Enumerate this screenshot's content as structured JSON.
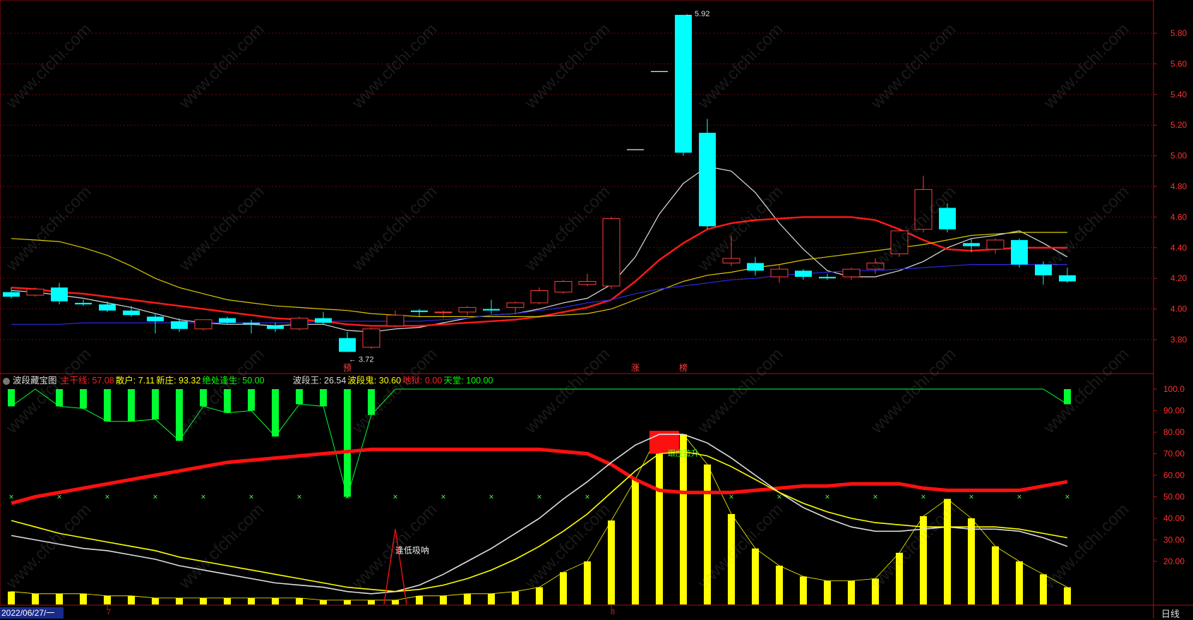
{
  "indicator_header": {
    "name": "波段藏宝图",
    "items": [
      {
        "label": "主干线",
        "value": "57.08",
        "color": "#ff2020"
      },
      {
        "label": "散户",
        "value": "7.11",
        "color": "#ffff00"
      },
      {
        "label": "新庄",
        "value": "93.32",
        "color": "#ffff00"
      },
      {
        "label": "绝处逢生",
        "value": "50.00",
        "color": "#00ff00"
      },
      {
        "label": "波段王",
        "value": "26.54",
        "color": "#dddddd"
      },
      {
        "label": "波段鬼",
        "value": "30.60",
        "color": "#ffff00"
      },
      {
        "label": "地狱",
        "value": "0.00",
        "color": "#ff2020"
      },
      {
        "label": "天堂",
        "value": "100.00",
        "color": "#00ff00"
      }
    ]
  },
  "date_label": "2022/06/27/一",
  "period_label": "日线",
  "watermark": "www.cfchi.com",
  "chart_data": [
    {
      "type": "candlestick",
      "title": "",
      "ylim": [
        3.62,
        5.98
      ],
      "price_ticks": [
        "5.80",
        "5.60",
        "5.40",
        "5.20",
        "5.00",
        "4.80",
        "4.60",
        "4.40",
        "4.20",
        "4.00",
        "3.80"
      ],
      "candles": [
        {
          "o": 4.11,
          "h": 4.14,
          "l": 4.07,
          "c": 4.08
        },
        {
          "o": 4.09,
          "h": 4.14,
          "l": 4.08,
          "c": 4.13
        },
        {
          "o": 4.14,
          "h": 4.17,
          "l": 4.03,
          "c": 4.05
        },
        {
          "o": 4.04,
          "h": 4.06,
          "l": 4.02,
          "c": 4.03
        },
        {
          "o": 4.03,
          "h": 4.05,
          "l": 3.98,
          "c": 3.99
        },
        {
          "o": 3.99,
          "h": 4.02,
          "l": 3.95,
          "c": 3.96
        },
        {
          "o": 3.95,
          "h": 3.97,
          "l": 3.84,
          "c": 3.92
        },
        {
          "o": 3.92,
          "h": 3.94,
          "l": 3.85,
          "c": 3.87
        },
        {
          "o": 3.87,
          "h": 3.93,
          "l": 3.86,
          "c": 3.93
        },
        {
          "o": 3.94,
          "h": 3.95,
          "l": 3.9,
          "c": 3.91
        },
        {
          "o": 3.91,
          "h": 3.93,
          "l": 3.84,
          "c": 3.9
        },
        {
          "o": 3.89,
          "h": 3.91,
          "l": 3.85,
          "c": 3.87
        },
        {
          "o": 3.87,
          "h": 3.95,
          "l": 3.86,
          "c": 3.94
        },
        {
          "o": 3.94,
          "h": 3.98,
          "l": 3.9,
          "c": 3.91
        },
        {
          "o": 3.81,
          "h": 3.85,
          "l": 3.72,
          "c": 3.72
        },
        {
          "o": 3.75,
          "h": 3.88,
          "l": 3.74,
          "c": 3.87
        },
        {
          "o": 3.89,
          "h": 3.99,
          "l": 3.88,
          "c": 3.96
        },
        {
          "o": 3.99,
          "h": 4.0,
          "l": 3.95,
          "c": 3.98
        },
        {
          "o": 3.98,
          "h": 3.99,
          "l": 3.94,
          "c": 3.98
        },
        {
          "o": 3.98,
          "h": 4.02,
          "l": 3.96,
          "c": 4.01
        },
        {
          "o": 4.0,
          "h": 4.06,
          "l": 3.97,
          "c": 3.99
        },
        {
          "o": 4.01,
          "h": 4.05,
          "l": 3.97,
          "c": 4.04
        },
        {
          "o": 4.04,
          "h": 4.14,
          "l": 4.03,
          "c": 4.12
        },
        {
          "o": 4.11,
          "h": 4.19,
          "l": 4.1,
          "c": 4.18
        },
        {
          "o": 4.16,
          "h": 4.23,
          "l": 4.15,
          "c": 4.18
        },
        {
          "o": 4.15,
          "h": 4.6,
          "l": 4.13,
          "c": 4.59
        },
        {
          "o": 5.04,
          "h": 5.04,
          "l": 5.04,
          "c": 5.04
        },
        {
          "o": 5.55,
          "h": 5.55,
          "l": 5.55,
          "c": 5.55
        },
        {
          "o": 5.92,
          "h": 5.92,
          "l": 5.0,
          "c": 5.02
        },
        {
          "o": 5.15,
          "h": 5.24,
          "l": 4.52,
          "c": 4.54
        },
        {
          "o": 4.3,
          "h": 4.48,
          "l": 4.28,
          "c": 4.33
        },
        {
          "o": 4.3,
          "h": 4.34,
          "l": 4.22,
          "c": 4.25
        },
        {
          "o": 4.21,
          "h": 4.29,
          "l": 4.17,
          "c": 4.26
        },
        {
          "o": 4.25,
          "h": 4.26,
          "l": 4.19,
          "c": 4.21
        },
        {
          "o": 4.21,
          "h": 4.23,
          "l": 4.19,
          "c": 4.2
        },
        {
          "o": 4.21,
          "h": 4.27,
          "l": 4.19,
          "c": 4.26
        },
        {
          "o": 4.26,
          "h": 4.33,
          "l": 4.23,
          "c": 4.3
        },
        {
          "o": 4.36,
          "h": 4.52,
          "l": 4.34,
          "c": 4.51
        },
        {
          "o": 4.52,
          "h": 4.87,
          "l": 4.5,
          "c": 4.78
        },
        {
          "o": 4.66,
          "h": 4.69,
          "l": 4.5,
          "c": 4.52
        },
        {
          "o": 4.43,
          "h": 4.46,
          "l": 4.37,
          "c": 4.41
        },
        {
          "o": 4.39,
          "h": 4.46,
          "l": 4.36,
          "c": 4.45
        },
        {
          "o": 4.45,
          "h": 4.46,
          "l": 4.27,
          "c": 4.29
        },
        {
          "o": 4.29,
          "h": 4.31,
          "l": 4.16,
          "c": 4.22
        },
        {
          "o": 4.22,
          "h": 4.27,
          "l": 4.17,
          "c": 4.18
        }
      ],
      "annotations": [
        {
          "text": "5.92",
          "index": 28,
          "price": 5.92,
          "color": "#dddddd"
        },
        {
          "text": "3.72",
          "index": 14,
          "price": 3.72,
          "color": "#dddddd"
        }
      ],
      "marks": [
        {
          "text": "预",
          "index": 14,
          "color": "#ff4040"
        },
        {
          "text": "涨",
          "index": 26,
          "color": "#ff4040"
        },
        {
          "text": "榜",
          "index": 28,
          "color": "#ff4040"
        }
      ],
      "series": [
        {
          "color": "#dddddd",
          "values": [
            4.12,
            4.11,
            4.09,
            4.07,
            4.04,
            4.01,
            3.97,
            3.93,
            3.91,
            3.9,
            3.9,
            3.89,
            3.9,
            3.9,
            3.86,
            3.85,
            3.87,
            3.88,
            3.91,
            3.94,
            3.96,
            3.97,
            4.0,
            4.04,
            4.07,
            4.16,
            4.34,
            4.62,
            4.82,
            4.93,
            4.9,
            4.76,
            4.56,
            4.39,
            4.25,
            4.21,
            4.21,
            4.25,
            4.31,
            4.4,
            4.46,
            4.48,
            4.51,
            4.43,
            4.34
          ]
        },
        {
          "color": "#ff1a1a",
          "values": [
            4.14,
            4.13,
            4.11,
            4.1,
            4.08,
            4.06,
            4.04,
            4.02,
            4.0,
            3.98,
            3.96,
            3.94,
            3.93,
            3.92,
            3.9,
            3.89,
            3.89,
            3.89,
            3.9,
            3.91,
            3.92,
            3.93,
            3.95,
            3.98,
            4.01,
            4.06,
            4.18,
            4.32,
            4.43,
            4.52,
            4.56,
            4.58,
            4.59,
            4.6,
            4.6,
            4.6,
            4.58,
            4.52,
            4.45,
            4.39,
            4.38,
            4.39,
            4.4,
            4.4,
            4.4
          ]
        },
        {
          "color": "#d8c800",
          "values": [
            4.46,
            4.45,
            4.44,
            4.4,
            4.35,
            4.28,
            4.2,
            4.14,
            4.1,
            4.06,
            4.04,
            4.02,
            4.01,
            4.0,
            3.99,
            3.97,
            3.96,
            3.95,
            3.95,
            3.95,
            3.95,
            3.95,
            3.95,
            3.96,
            3.97,
            4.0,
            4.06,
            4.12,
            4.18,
            4.22,
            4.24,
            4.27,
            4.29,
            4.32,
            4.34,
            4.36,
            4.38,
            4.4,
            4.42,
            4.45,
            4.48,
            4.49,
            4.5,
            4.5,
            4.5
          ]
        },
        {
          "color": "#2a2ae0",
          "values": [
            3.9,
            3.9,
            3.9,
            3.91,
            3.91,
            3.91,
            3.91,
            3.91,
            3.91,
            3.91,
            3.91,
            3.91,
            3.91,
            3.92,
            3.92,
            3.92,
            3.92,
            3.92,
            3.93,
            3.94,
            3.96,
            3.97,
            3.99,
            4.01,
            4.04,
            4.06,
            4.1,
            4.13,
            4.15,
            4.17,
            4.19,
            4.2,
            4.22,
            4.23,
            4.24,
            4.25,
            4.25,
            4.26,
            4.27,
            4.28,
            4.29,
            4.29,
            4.29,
            4.29,
            4.29
          ]
        }
      ]
    },
    {
      "type": "bar",
      "title": "波段藏宝图",
      "ylim": [
        0,
        101
      ],
      "yticks": [
        "100.0",
        "90.00",
        "80.00",
        "70.00",
        "60.00",
        "50.00",
        "40.00",
        "30.00",
        "20.00"
      ],
      "green_bars": [
        92,
        100,
        92,
        91,
        85,
        85,
        86,
        76,
        92,
        89,
        90,
        78,
        93,
        92,
        50,
        88,
        100,
        100,
        100,
        100,
        100,
        100,
        100,
        100,
        100,
        100,
        100,
        100,
        100,
        100,
        100,
        100,
        100,
        100,
        100,
        100,
        100,
        100,
        100,
        100,
        100,
        100,
        100,
        100,
        93
      ],
      "yellow_bars": [
        6,
        5,
        5,
        5,
        4,
        4,
        3,
        3,
        3,
        3,
        3,
        3,
        3,
        2,
        2,
        2,
        2,
        4,
        4,
        5,
        5,
        6,
        8,
        15,
        20,
        39,
        58,
        80,
        79,
        65,
        42,
        26,
        18,
        13,
        11,
        11,
        12,
        24,
        41,
        49,
        40,
        27,
        20,
        14,
        8
      ],
      "lines": [
        {
          "name": "主干线",
          "color": "#ff1010",
          "values": [
            47,
            50,
            52,
            54,
            56,
            58,
            60,
            62,
            64,
            66,
            67,
            68,
            69,
            70,
            71,
            72,
            72,
            72,
            72,
            72,
            72,
            72,
            72,
            71,
            70,
            65,
            58,
            53,
            52,
            52,
            52,
            53,
            54,
            55,
            55,
            56,
            56,
            56,
            54,
            53,
            53,
            53,
            53,
            55,
            57
          ]
        },
        {
          "name": "波段王",
          "color": "#dddddd",
          "values": [
            32,
            30,
            28,
            26,
            25,
            23,
            21,
            18,
            16,
            14,
            12,
            10,
            9,
            8,
            6,
            5,
            6,
            9,
            14,
            20,
            26,
            33,
            40,
            49,
            57,
            66,
            74,
            79,
            79,
            75,
            68,
            60,
            52,
            45,
            40,
            36,
            34,
            34,
            35,
            36,
            35,
            35,
            34,
            31,
            27
          ]
        },
        {
          "name": "波段鬼",
          "color": "#ffff00",
          "values": [
            39,
            36,
            33,
            31,
            29,
            27,
            25,
            22,
            20,
            18,
            16,
            14,
            12,
            10,
            8,
            7,
            6,
            7,
            9,
            12,
            16,
            21,
            27,
            34,
            42,
            52,
            62,
            70,
            71,
            69,
            64,
            58,
            52,
            47,
            43,
            40,
            38,
            37,
            36,
            36,
            36,
            36,
            35,
            33,
            31
          ]
        }
      ],
      "marker_value": 50,
      "red_triangle": {
        "index": 16,
        "value": 35,
        "label": "逢低吸呐"
      },
      "red_block": {
        "index": 27,
        "value": 80,
        "label": "跟庄拉升"
      }
    }
  ]
}
